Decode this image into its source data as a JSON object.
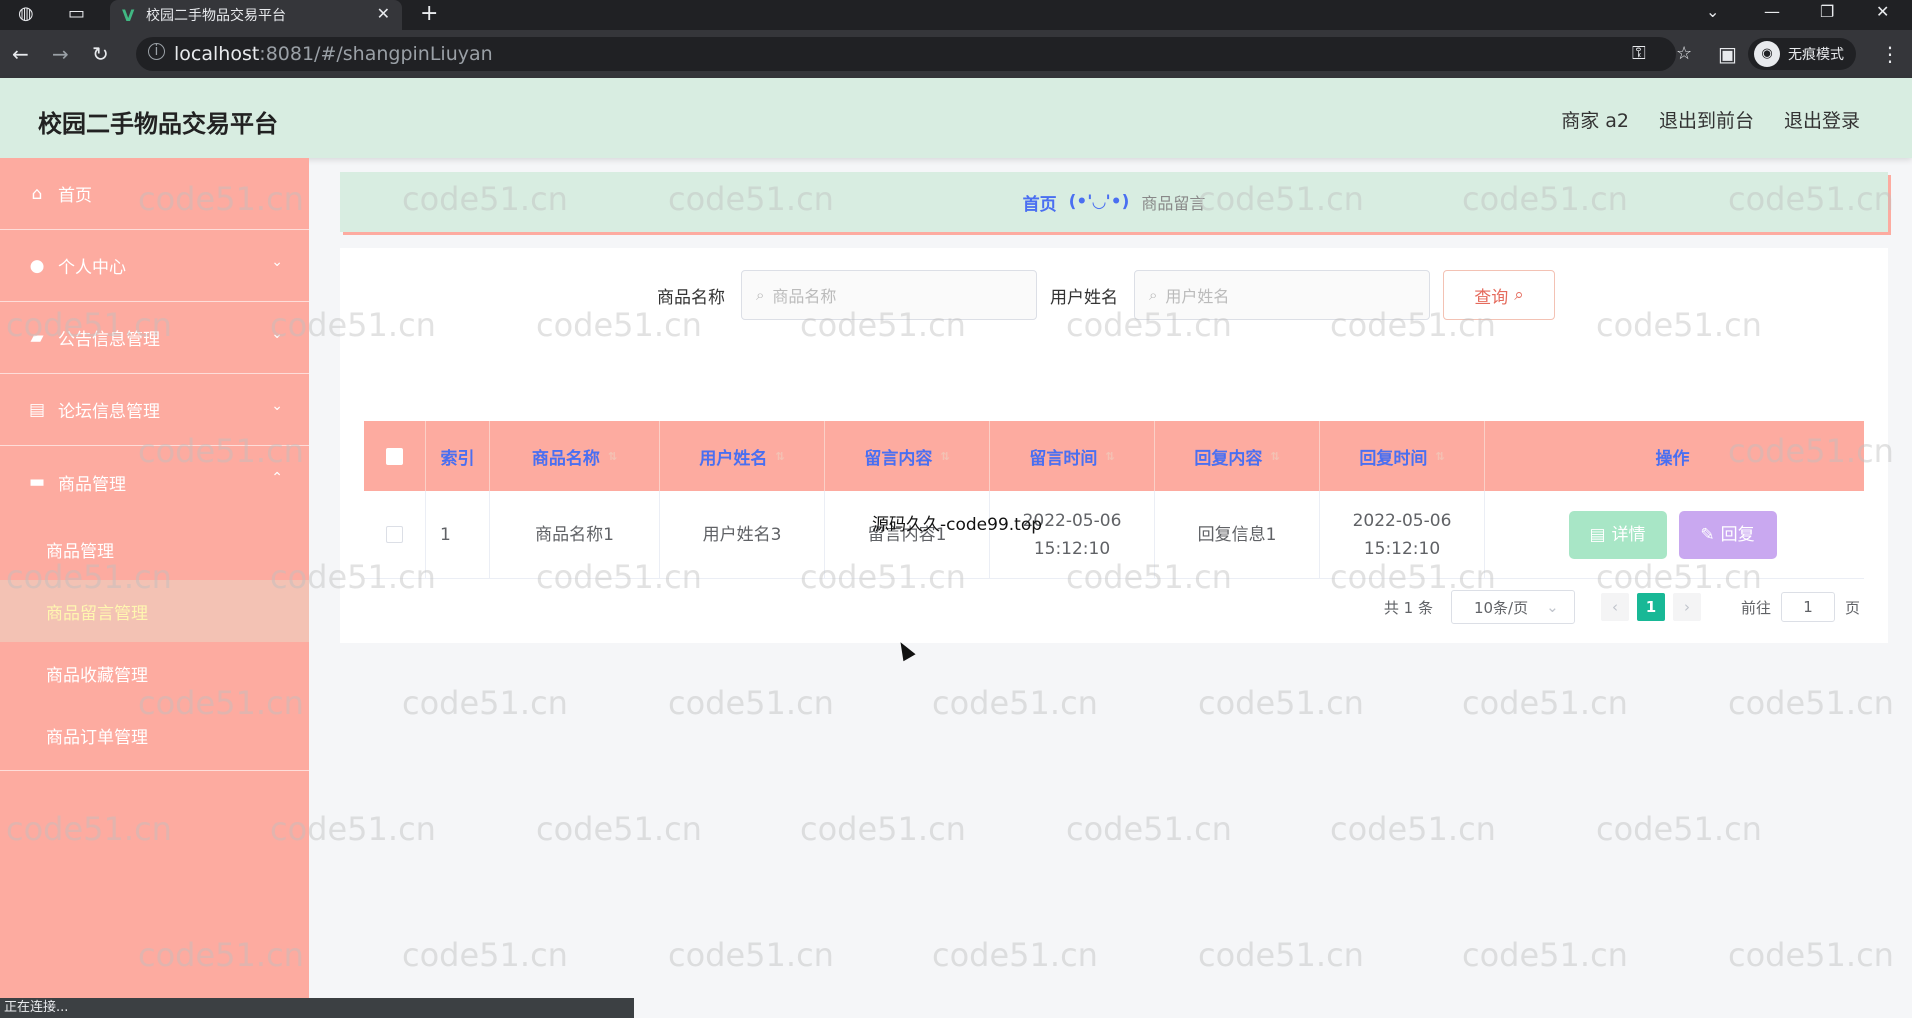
{
  "browser": {
    "tab_title": "校园二手物品交易平台",
    "url_host": "localhost",
    "url_path": ":8081/#/shangpinLiuyan",
    "incognito_label": "无痕模式",
    "status_text": "正在连接..."
  },
  "header": {
    "title": "校园二手物品交易平台",
    "user": "商家 a2",
    "to_front": "退出到前台",
    "logout": "退出登录"
  },
  "sidebar": {
    "items": [
      {
        "label": "首页",
        "icon": "home-icon"
      },
      {
        "label": "个人中心",
        "icon": "user-icon"
      },
      {
        "label": "公告信息管理",
        "icon": "ticket-icon"
      },
      {
        "label": "论坛信息管理",
        "icon": "clipboard-icon"
      },
      {
        "label": "商品管理",
        "icon": "briefcase-icon"
      }
    ],
    "subitems": [
      "商品管理",
      "商品留言管理",
      "商品收藏管理",
      "商品订单管理"
    ],
    "active_subitem": "商品留言管理"
  },
  "breadcrumb": {
    "home": "首页",
    "separator": "(•'◡'•)",
    "current": "商品留言"
  },
  "search": {
    "label1": "商品名称",
    "placeholder1": "商品名称",
    "label2": "用户姓名",
    "placeholder2": "用户姓名",
    "button": "查询"
  },
  "table": {
    "headers": [
      "索引",
      "商品名称",
      "用户姓名",
      "留言内容",
      "留言时间",
      "回复内容",
      "回复时间",
      "操作"
    ],
    "rows": [
      {
        "index": "1",
        "product": "商品名称1",
        "user": "用户姓名3",
        "content": "留言内容1",
        "time": "2022-05-06 15:12:10",
        "reply": "回复信息1",
        "reply_time": "2022-05-06 15:12:10"
      }
    ],
    "detail_btn": "详情",
    "reply_btn": "回复"
  },
  "pagination": {
    "total": "共 1 条",
    "page_size": "10条/页",
    "current_page": "1",
    "goto_label": "前往",
    "goto_value": "1",
    "page_suffix": "页"
  },
  "overlay_text": "源码久久-code99.top",
  "watermark": "code51.cn",
  "colors": {
    "header_bg": "#d8ede1",
    "sidebar_bg": "#fdaba0",
    "accent": "#4a6ff1",
    "pager_active": "#18b896"
  }
}
